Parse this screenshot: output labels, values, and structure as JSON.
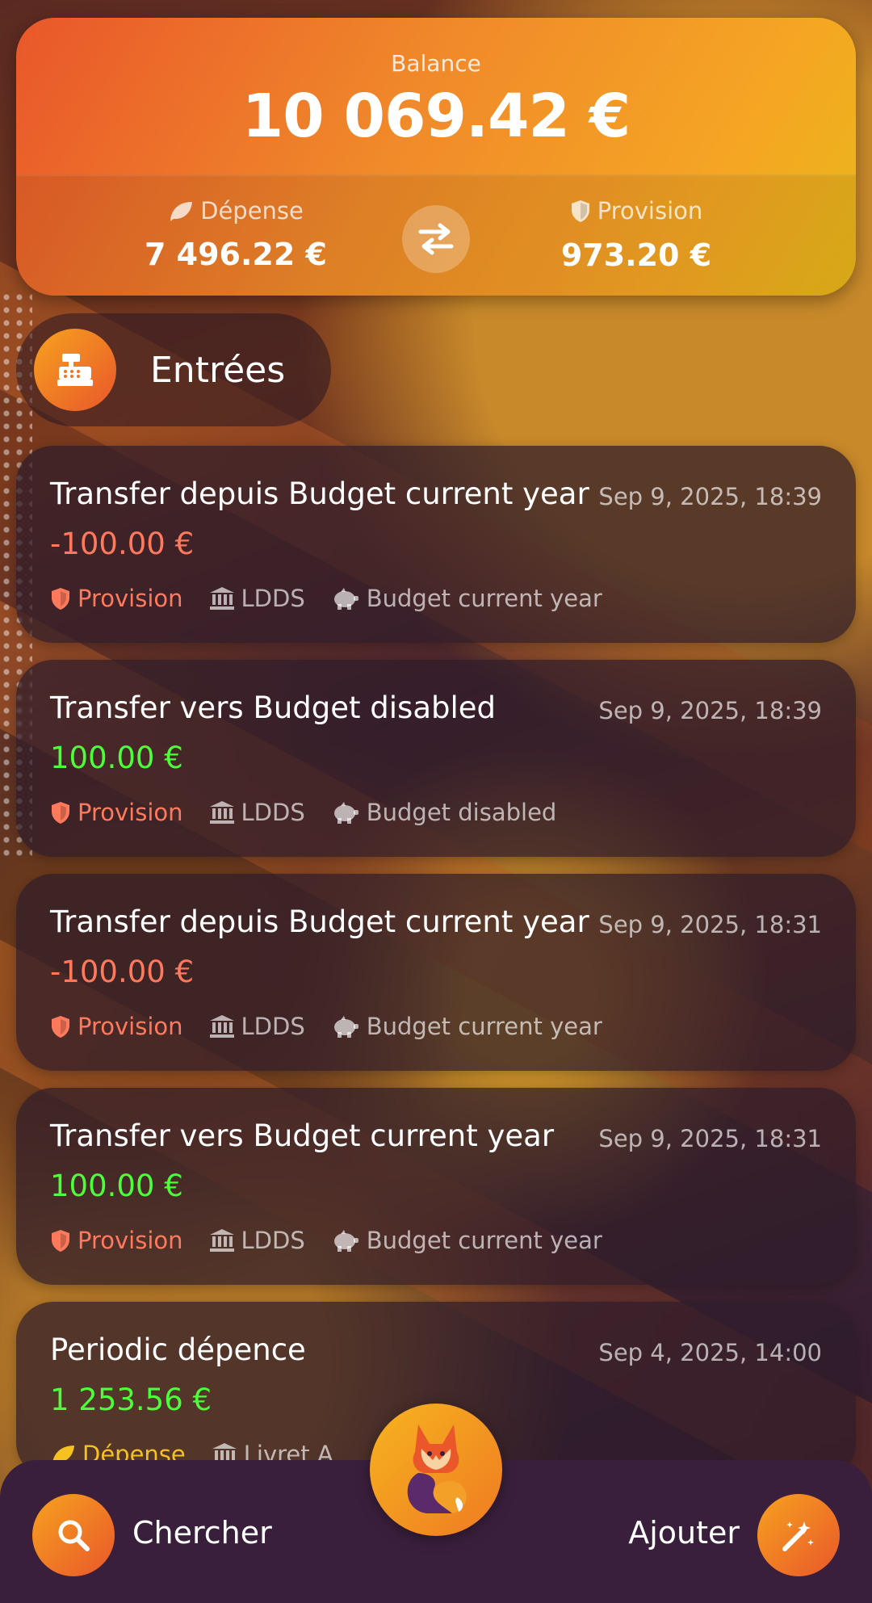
{
  "summary": {
    "balance_label": "Balance",
    "balance_value": "10 069.42 €",
    "expense_label": "Dépense",
    "expense_value": "7 496.22 €",
    "provision_label": "Provision",
    "provision_value": "973.20 €"
  },
  "section": {
    "title": "Entrées"
  },
  "entries": [
    {
      "title": "Transfer depuis Budget current year",
      "date": "Sep 9, 2025, 18:39",
      "amount": "-100.00 €",
      "type_label": "Provision",
      "account": "LDDS",
      "budget": "Budget current year"
    },
    {
      "title": "Transfer vers Budget disabled",
      "date": "Sep 9, 2025, 18:39",
      "amount": "100.00 €",
      "type_label": "Provision",
      "account": "LDDS",
      "budget": "Budget disabled"
    },
    {
      "title": "Transfer depuis Budget current year",
      "date": "Sep 9, 2025, 18:31",
      "amount": "-100.00 €",
      "type_label": "Provision",
      "account": "LDDS",
      "budget": "Budget current year"
    },
    {
      "title": "Transfer vers Budget current year",
      "date": "Sep 9, 2025, 18:31",
      "amount": "100.00 €",
      "type_label": "Provision",
      "account": "LDDS",
      "budget": "Budget current year"
    },
    {
      "title": "Periodic dépence",
      "date": "Sep 4, 2025, 14:00",
      "amount": "1 253.56 €",
      "type_label": "Dépense",
      "account": "Livret A"
    }
  ],
  "bottom_bar": {
    "search_label": "Chercher",
    "add_label": "Ajouter"
  },
  "colors": {
    "accent": "#f5a623",
    "negative": "#ff7a5c",
    "positive": "#4dff3a",
    "expense_tag": "#f6c21f"
  }
}
